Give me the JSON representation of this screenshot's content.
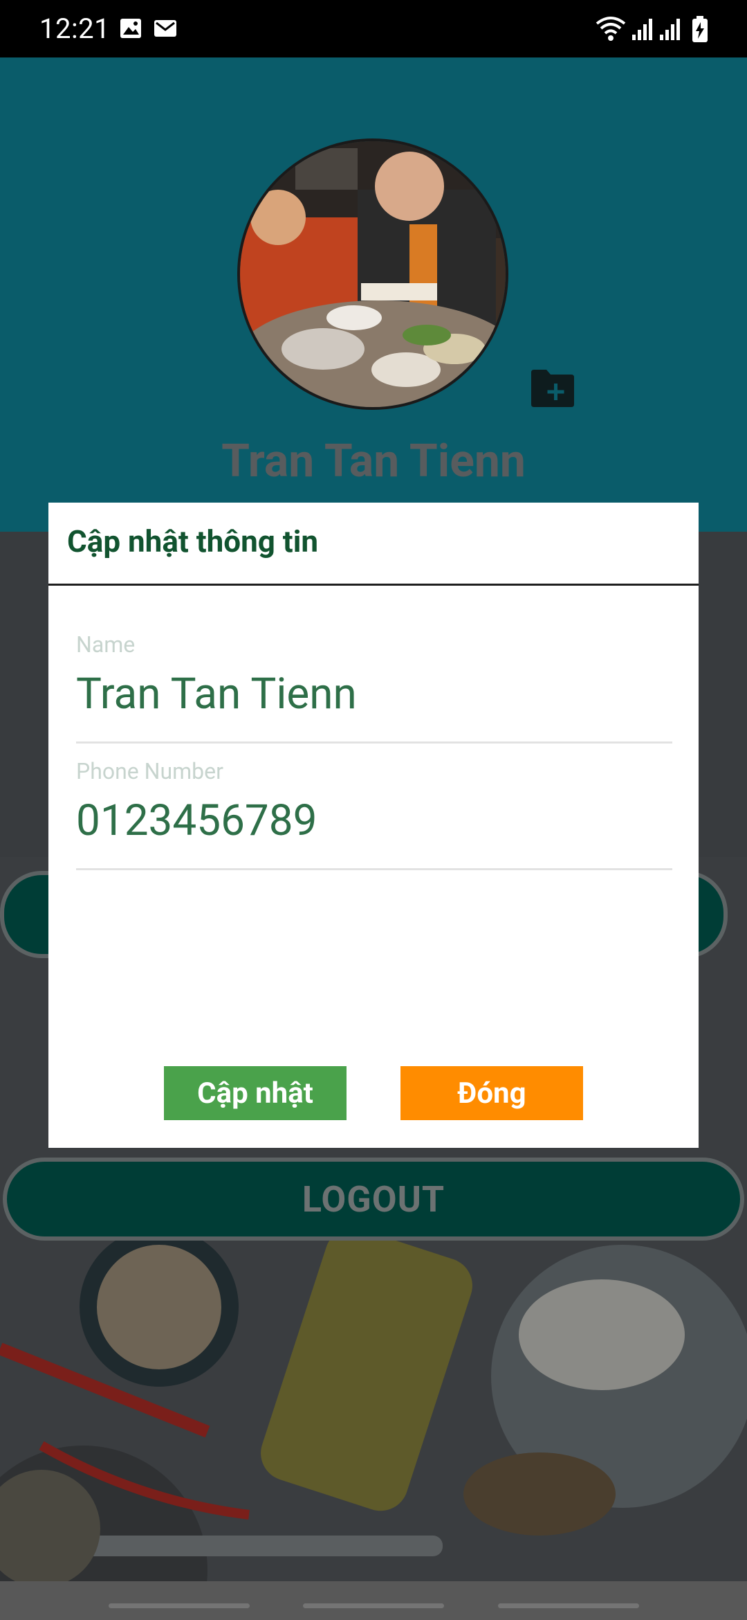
{
  "status_bar": {
    "time": "12:21",
    "left_icons": [
      "image-icon",
      "gmail-icon"
    ],
    "right_icons": [
      "wifi-icon",
      "signal-icon",
      "signal-icon",
      "battery-charging-icon"
    ]
  },
  "profile": {
    "name": "Tran Tan Tienn"
  },
  "background": {
    "logout_label": "LOGOUT"
  },
  "dialog": {
    "title": "Cập nhật thông tin",
    "name_field": {
      "label": "Name",
      "value": "Tran Tan Tienn"
    },
    "phone_field": {
      "label": "Phone Number",
      "value": "0123456789"
    },
    "update_button": "Cập nhật",
    "close_button": "Đóng"
  },
  "colors": {
    "header": "#0a5c6a",
    "dialog_title": "#11532f",
    "input_text": "#2e6f48",
    "update_button": "#4aa24b",
    "close_button": "#ff8c00"
  }
}
